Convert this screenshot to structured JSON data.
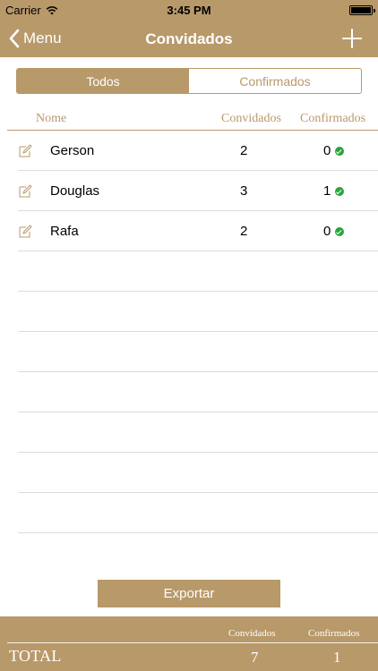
{
  "status_bar": {
    "carrier": "Carrier",
    "time": "3:45 PM",
    "icons": [
      "wifi-icon",
      "battery-icon"
    ]
  },
  "nav": {
    "back_label": "Menu",
    "title": "Convidados",
    "icons": [
      "chevron-left-icon",
      "plus-icon"
    ]
  },
  "segments": {
    "all": "Todos",
    "confirmed": "Confirmados",
    "selected": "Todos"
  },
  "table": {
    "columns": {
      "name": "Nome",
      "guests": "Convidados",
      "confirmed": "Confirmados"
    },
    "rows": [
      {
        "name": "Gerson",
        "guests": "2",
        "confirmed": "0"
      },
      {
        "name": "Douglas",
        "guests": "3",
        "confirmed": "1"
      },
      {
        "name": "Rafa",
        "guests": "2",
        "confirmed": "0"
      }
    ]
  },
  "export_label": "Exportar",
  "footer": {
    "guests_label": "Convidados",
    "confirmed_label": "Confirmados",
    "total_label": "TOTAL",
    "total_guests": "7",
    "total_confirmed": "1"
  },
  "colors": {
    "accent": "#b8996a",
    "check": "#2aa43c",
    "separator": "#dcdcdc"
  }
}
